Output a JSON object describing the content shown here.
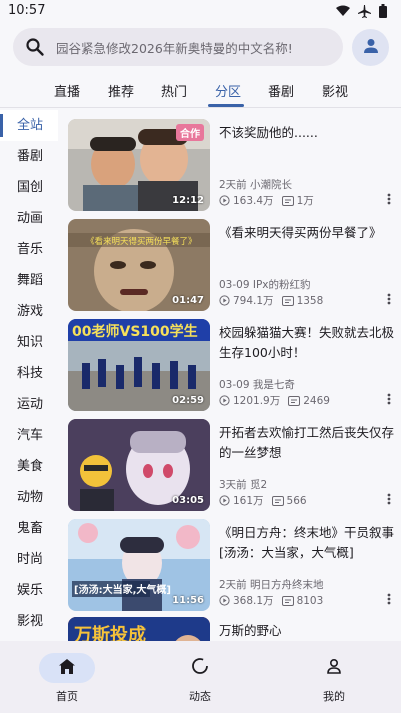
{
  "status_bar": {
    "time": "10:57"
  },
  "search": {
    "placeholder": "园谷紧急修改2026年新奥特曼的中文名称!"
  },
  "tabs": [
    {
      "label": "直播"
    },
    {
      "label": "推荐"
    },
    {
      "label": "热门"
    },
    {
      "label": "分区",
      "active": true
    },
    {
      "label": "番剧"
    },
    {
      "label": "影视"
    }
  ],
  "sidebar": [
    {
      "label": "全站",
      "active": true
    },
    {
      "label": "番剧"
    },
    {
      "label": "国创"
    },
    {
      "label": "动画"
    },
    {
      "label": "音乐"
    },
    {
      "label": "舞蹈"
    },
    {
      "label": "游戏"
    },
    {
      "label": "知识"
    },
    {
      "label": "科技"
    },
    {
      "label": "运动"
    },
    {
      "label": "汽车"
    },
    {
      "label": "美食"
    },
    {
      "label": "动物"
    },
    {
      "label": "鬼畜"
    },
    {
      "label": "时尚"
    },
    {
      "label": "娱乐"
    },
    {
      "label": "影视"
    }
  ],
  "videos": [
    {
      "title": "不该奖励他的......",
      "badge": "合作",
      "duration": "12:12",
      "date": "2天前",
      "author": "小潮院长",
      "views": "163.4万",
      "danmaku": "1万"
    },
    {
      "title": "《看来明天得买两份早餐了》",
      "duration": "01:47",
      "date": "03-09",
      "author": "IPx的粉红豹",
      "views": "794.1万",
      "danmaku": "1358"
    },
    {
      "title": "校园躲猫猫大赛！失败就去北极生存100小时！",
      "duration": "02:59",
      "date": "03-09",
      "author": "我是七奇",
      "views": "1201.9万",
      "danmaku": "2469"
    },
    {
      "title": "开拓者去欢愉打工然后丧失仅存的一丝梦想",
      "duration": "03:05",
      "date": "3天前",
      "author": "觅2",
      "views": "161万",
      "danmaku": "566"
    },
    {
      "title": "《明日方舟：终末地》干员叙事 [汤汤：大当家，大气概]",
      "duration": "11:56",
      "date": "2天前",
      "author": "明日方舟终末地",
      "views": "368.1万",
      "danmaku": "8103"
    },
    {
      "title": "万斯的野心"
    }
  ],
  "bottom_nav": [
    {
      "label": "首页",
      "active": true
    },
    {
      "label": "动态"
    },
    {
      "label": "我的"
    }
  ],
  "colors": {
    "accent": "#3a62a8",
    "badge": "#e8779b"
  }
}
